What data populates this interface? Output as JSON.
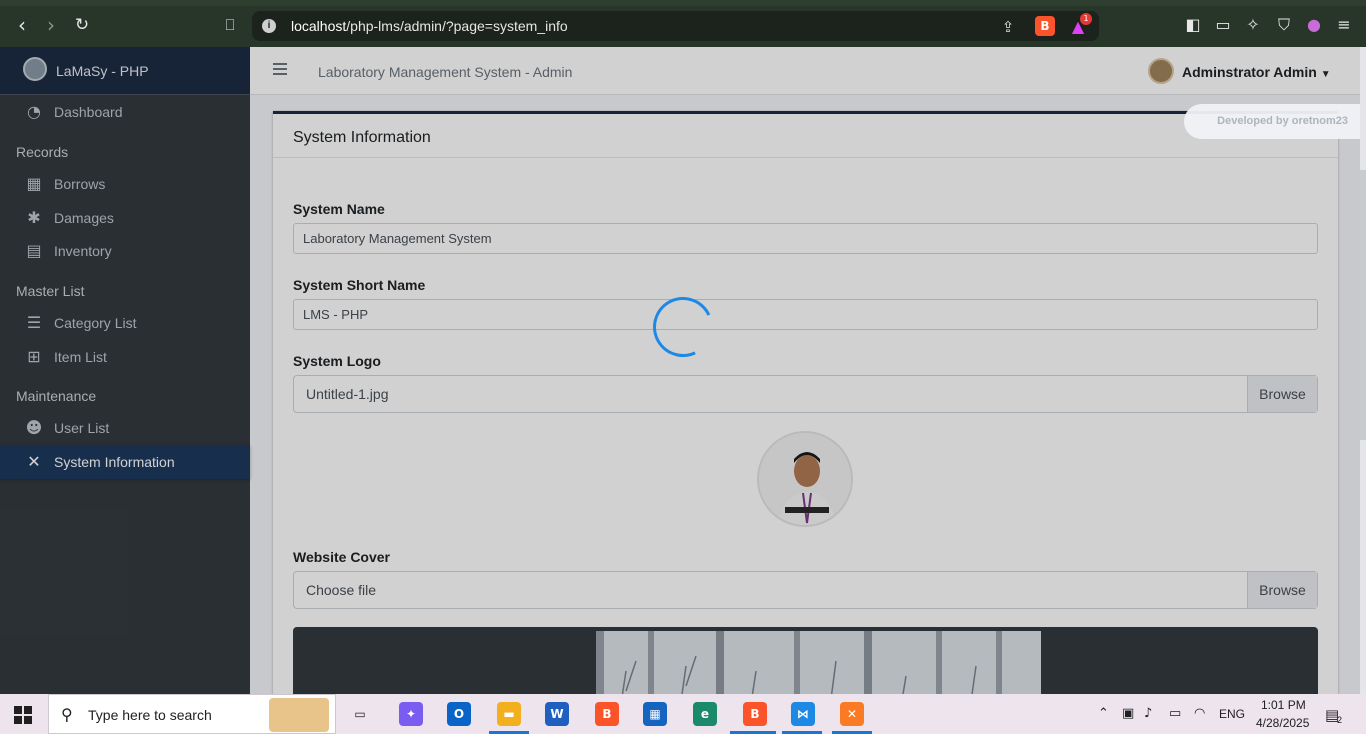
{
  "browser": {
    "url_host": "localhost",
    "url_path": "/php-lms/admin/?page=system_info",
    "brave_badge": "1"
  },
  "sidebar": {
    "brand": "LaMaSy - PHP",
    "dashboard": "Dashboard",
    "sections": {
      "records": "Records",
      "master_list": "Master List",
      "maintenance": "Maintenance"
    },
    "items": {
      "borrows": "Borrows",
      "damages": "Damages",
      "inventory": "Inventory",
      "category_list": "Category List",
      "item_list": "Item List",
      "user_list": "User List",
      "system_information": "System Information"
    }
  },
  "topnav": {
    "title": "Laboratory Management System - Admin",
    "user": "Adminstrator Admin"
  },
  "card": {
    "title": "System Information",
    "developer": "Developed by oretnom23"
  },
  "form": {
    "system_name_label": "System Name",
    "system_name_value": "Laboratory Management System",
    "short_name_label": "System Short Name",
    "short_name_value": "LMS - PHP",
    "logo_label": "System Logo",
    "logo_file": "Untitled-1.jpg",
    "browse": "Browse",
    "cover_label": "Website Cover",
    "cover_file": "Choose file"
  },
  "taskbar": {
    "search_placeholder": "Type here to search",
    "language": "ENG",
    "time": "1:01 PM",
    "date": "4/28/2025",
    "notifications": "2"
  },
  "colors": {
    "sidebar_bg": "#343a40",
    "brand_bg": "#1d2d44",
    "active_item": "#1d3a5f",
    "spinner": "#1e88e5"
  }
}
